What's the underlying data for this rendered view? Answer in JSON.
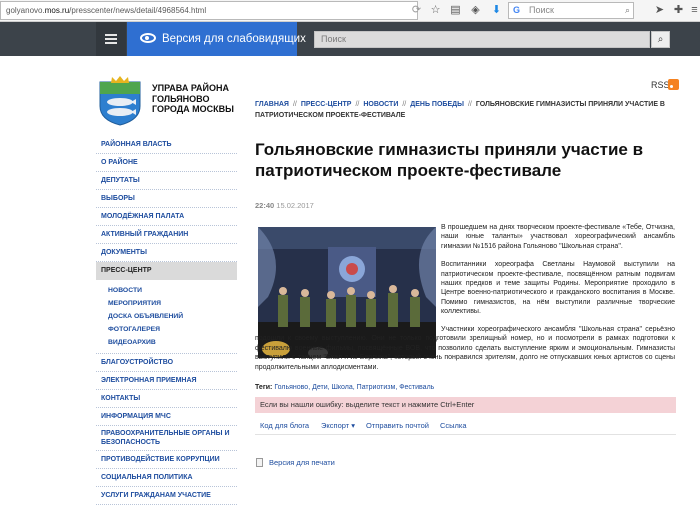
{
  "browser": {
    "url_prefix": "golyanovo.",
    "url_domain": "mos.ru",
    "url_path": "/presscenter/news/detail/4968564.html",
    "search_placeholder": "Поиск"
  },
  "header": {
    "accessibility_label": "Версия для слабовидящих",
    "search_placeholder": "Поиск"
  },
  "logo": {
    "line1": "УПРАВА РАЙОНА",
    "line2": "ГОЛЬЯНОВО",
    "line3": "ГОРОДА МОСКВЫ"
  },
  "rss_label": "RSS",
  "sidebar": {
    "items_top": [
      "Районная власть",
      "О районе",
      "Депутаты",
      "Выборы",
      "Молодёжная палата",
      "Активный гражданин",
      "Документы"
    ],
    "active": "Пресс-центр",
    "sub_items": [
      "Новости",
      "Мероприятия",
      "Доска объявлений",
      "Фотогалерея",
      "Видеоархив"
    ],
    "items_bottom": [
      "Благоустройство",
      "Электронная приемная",
      "Контакты",
      "Информация МЧС",
      "Правоохранительные органы и безопасность",
      "Противодействие коррупции",
      "Социальная политика",
      "Услуги гражданам участие"
    ]
  },
  "breadcrumb": {
    "items": [
      "Главная",
      "Пресс-центр",
      "Новости",
      "День победы"
    ],
    "current": "Гольяновские гимназисты приняли участие в патриотическом проекте-фестивале"
  },
  "article": {
    "title": "Гольяновские гимназисты приняли участие в патриотическом проекте-фестивале",
    "time": "22:40",
    "date": "15.02.2017",
    "p1": "В прошедшем на днях творческом проекте-фестивале «Тебе, Отчизна, наши юные таланты» участвовал хореографический ансамбль гимназии №1516 района Гольяново \"Школьная страна\".",
    "p2": "Воспитанники хореографа Светланы Наумовой выступили на патриотическом проекте-фестивале, посвящённом ратным подвигам наших предков и теме защиты Родины. Мероприятие проходило в Центре военно-патриотического и гражданского воспитания в Москве. Помимо гимназистов, на нём выступили различные творческие коллективы.",
    "p3": "Участники хореографического ансамбля \"Школьная страна\" серьёзно подошли к своему выступлению. Они не только подготовили зрелищный номер, но и посмотрели в рамках подготовки к фестивалю военные фильмы, посвящённые ВОВ, что позволило сделать выступление ярким и эмоциональным. Гимназисты выступили с танцем \"Ехал я из Берлина\", который очень понравился зрителям, долго не отпускавших юных артистов со сцены продолжительными аплодисментами.",
    "tags_label": "Теги:",
    "tags": "Гольяново, Дети, Школа, Патриотизм, Фестиваль"
  },
  "error_notice": "Если вы нашли ошибку: выделите текст и нажмите Ctrl+Enter",
  "actions": {
    "blog_code": "Код для блога",
    "export": "Экспорт",
    "send_email": "Отправить почтой",
    "link": "Ссылка"
  },
  "print_version": "Версия для печати",
  "colors": {
    "accent_blue": "#2f6fd1",
    "link_blue": "#1d4c9e",
    "header_dark": "#3c434a",
    "error_pink": "#f4d2d6"
  }
}
